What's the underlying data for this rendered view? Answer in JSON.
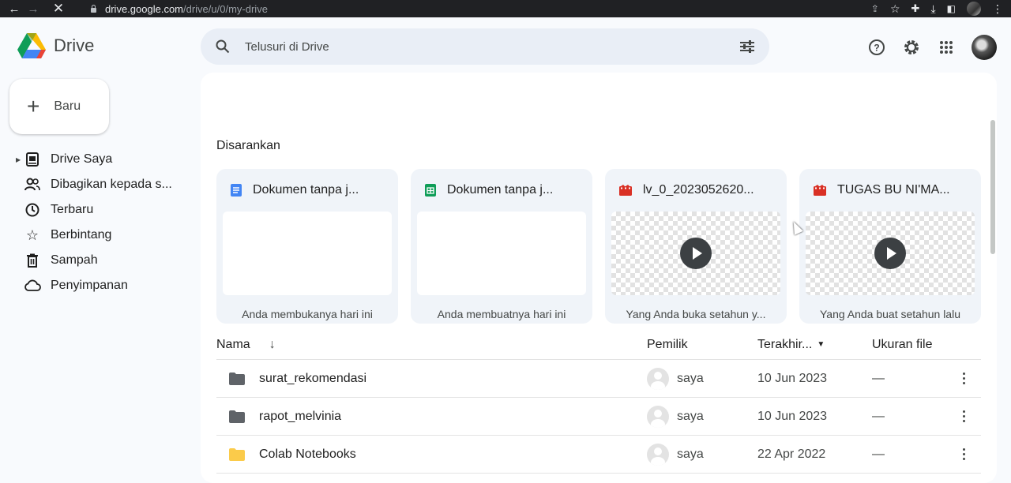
{
  "browser": {
    "url_host": "drive.google.com",
    "url_path": "/drive/u/0/my-drive"
  },
  "app": {
    "name": "Drive"
  },
  "search": {
    "placeholder": "Telusuri di Drive"
  },
  "new_button": {
    "label": "Baru"
  },
  "sidebar": {
    "items": [
      {
        "label": "Drive Saya",
        "icon": "my-drive-icon"
      },
      {
        "label": "Dibagikan kepada s...",
        "icon": "shared-icon"
      },
      {
        "label": "Terbaru",
        "icon": "clock-icon"
      },
      {
        "label": "Berbintang",
        "icon": "star-icon"
      },
      {
        "label": "Sampah",
        "icon": "trash-icon"
      },
      {
        "label": "Penyimpanan",
        "icon": "cloud-icon"
      }
    ]
  },
  "suggested": {
    "title": "Disarankan",
    "cards": [
      {
        "title": "Dokumen tanpa j...",
        "type": "doc",
        "footer": "Anda membukanya hari ini"
      },
      {
        "title": "Dokumen tanpa j...",
        "type": "sheet",
        "footer": "Anda membuatnya hari ini"
      },
      {
        "title": "lv_0_2023052620...",
        "type": "video",
        "footer": "Yang Anda buka setahun y..."
      },
      {
        "title": "TUGAS BU NI'MA...",
        "type": "video",
        "footer": "Yang Anda buat setahun lalu"
      }
    ]
  },
  "table": {
    "headers": {
      "name": "Nama",
      "owner": "Pemilik",
      "modified": "Terakhir...",
      "size": "Ukuran file"
    },
    "rows": [
      {
        "name": "surat_rekomendasi",
        "folder_color": "#5f6368",
        "owner": "saya",
        "modified": "10 Jun 2023",
        "size": "—"
      },
      {
        "name": "rapot_melvinia",
        "folder_color": "#5f6368",
        "owner": "saya",
        "modified": "10 Jun 2023",
        "size": "—"
      },
      {
        "name": "Colab Notebooks",
        "folder_color": "#fbcb4a",
        "owner": "saya",
        "modified": "22 Apr 2022",
        "size": "—"
      }
    ]
  },
  "colors": {
    "doc_blue": "#4285f4",
    "sheet_green": "#0f9d58",
    "video_red": "#d93025",
    "folder_grey": "#5f6368",
    "folder_yellow": "#fbcb4a"
  }
}
